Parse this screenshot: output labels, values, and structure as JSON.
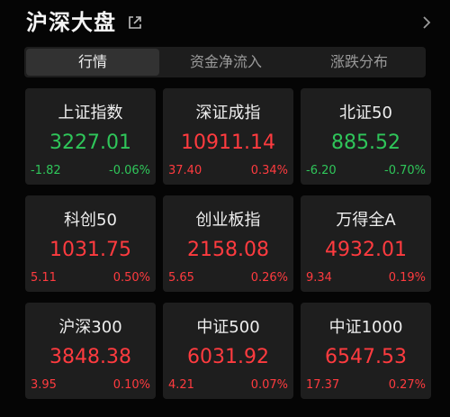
{
  "header": {
    "title": "沪深大盘"
  },
  "tabs": [
    {
      "label": "行情",
      "active": true
    },
    {
      "label": "资金净流入",
      "active": false
    },
    {
      "label": "涨跌分布",
      "active": false
    }
  ],
  "colors": {
    "up": "#ff3b3f",
    "down": "#2fc65a",
    "card_bg": "#1e1e1e",
    "page_bg": "#050505"
  },
  "indices": [
    {
      "name": "上证指数",
      "price": "3227.01",
      "change": "-1.82",
      "percent": "-0.06%",
      "direction": "down"
    },
    {
      "name": "深证成指",
      "price": "10911.14",
      "change": "37.40",
      "percent": "0.34%",
      "direction": "up"
    },
    {
      "name": "北证50",
      "price": "885.52",
      "change": "-6.20",
      "percent": "-0.70%",
      "direction": "down"
    },
    {
      "name": "科创50",
      "price": "1031.75",
      "change": "5.11",
      "percent": "0.50%",
      "direction": "up"
    },
    {
      "name": "创业板指",
      "price": "2158.08",
      "change": "5.65",
      "percent": "0.26%",
      "direction": "up"
    },
    {
      "name": "万得全A",
      "price": "4932.01",
      "change": "9.34",
      "percent": "0.19%",
      "direction": "up"
    },
    {
      "name": "沪深300",
      "price": "3848.38",
      "change": "3.95",
      "percent": "0.10%",
      "direction": "up"
    },
    {
      "name": "中证500",
      "price": "6031.92",
      "change": "4.21",
      "percent": "0.07%",
      "direction": "up"
    },
    {
      "name": "中证1000",
      "price": "6547.53",
      "change": "17.37",
      "percent": "0.27%",
      "direction": "up"
    }
  ],
  "icons": {
    "external": "external-link-icon",
    "more": "chevron-right-icon"
  }
}
